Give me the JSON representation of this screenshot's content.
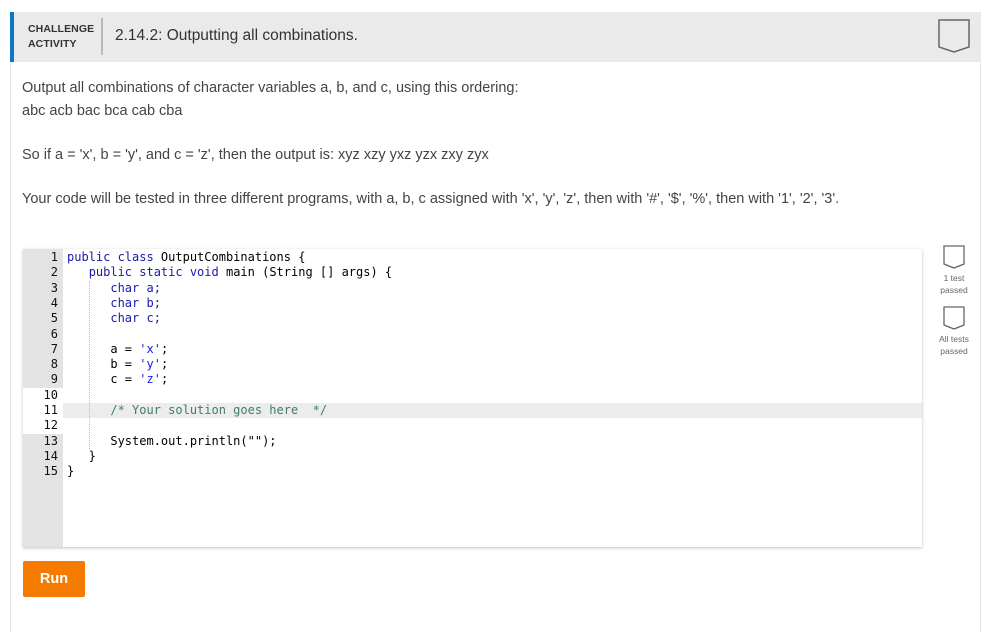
{
  "header": {
    "badge_line1": "CHALLENGE",
    "badge_line2": "ACTIVITY",
    "title": "2.14.2: Outputting all combinations.",
    "accent_color": "#0b78c6",
    "completion_icon": "bookmark-outline-icon"
  },
  "instructions": {
    "line1": "Output all combinations of character variables a, b, and c, using this ordering:",
    "line2": "abc acb bac bca cab cba",
    "example": "So if a = 'x', b = 'y', and c = 'z', then the output is: xyz xzy yxz yzx zxy zyx",
    "testing": "Your code will be tested in three different programs, with a, b, c assigned with 'x', 'y', 'z', then with '#', '$', '%', then with '1', '2', '3'."
  },
  "editor": {
    "active_line": 11,
    "editable_lines": [
      10,
      11,
      12
    ],
    "lines": [
      {
        "n": "1",
        "tokens": [
          [
            "kw",
            "public class "
          ],
          [
            "",
            "OutputCombinations {"
          ]
        ]
      },
      {
        "n": "2",
        "tokens": [
          [
            "",
            "   "
          ],
          [
            "kw",
            "public static void "
          ],
          [
            "",
            "main (String [] args) {"
          ]
        ]
      },
      {
        "n": "3",
        "tokens": [
          [
            "",
            "      "
          ],
          [
            "kw",
            "char "
          ],
          [
            "kw",
            "a;"
          ]
        ]
      },
      {
        "n": "4",
        "tokens": [
          [
            "",
            "      "
          ],
          [
            "kw",
            "char "
          ],
          [
            "kw",
            "b;"
          ]
        ]
      },
      {
        "n": "5",
        "tokens": [
          [
            "",
            "      "
          ],
          [
            "kw",
            "char "
          ],
          [
            "kw",
            "c;"
          ]
        ]
      },
      {
        "n": "6",
        "tokens": []
      },
      {
        "n": "7",
        "tokens": [
          [
            "",
            "      a = "
          ],
          [
            "str",
            "'x'"
          ],
          [
            "",
            ";"
          ]
        ]
      },
      {
        "n": "8",
        "tokens": [
          [
            "",
            "      b = "
          ],
          [
            "str",
            "'y'"
          ],
          [
            "",
            ";"
          ]
        ]
      },
      {
        "n": "9",
        "tokens": [
          [
            "",
            "      c = "
          ],
          [
            "str",
            "'z'"
          ],
          [
            "",
            ";"
          ]
        ]
      },
      {
        "n": "10",
        "tokens": []
      },
      {
        "n": "11",
        "tokens": [
          [
            "",
            "      "
          ],
          [
            "cm",
            "/* Your solution goes here  */"
          ]
        ]
      },
      {
        "n": "12",
        "tokens": []
      },
      {
        "n": "13",
        "tokens": [
          [
            "",
            "      System.out.println(\"\");"
          ]
        ]
      },
      {
        "n": "14",
        "tokens": [
          [
            "",
            "   }"
          ]
        ]
      },
      {
        "n": "15",
        "tokens": [
          [
            "",
            "}"
          ]
        ]
      }
    ]
  },
  "tests": [
    {
      "label_line1": "1 test",
      "label_line2": "passed",
      "icon": "bookmark-outline-icon"
    },
    {
      "label_line1": "All tests",
      "label_line2": "passed",
      "icon": "bookmark-outline-icon"
    }
  ],
  "run_button": {
    "label": "Run",
    "color": "#f57a00"
  }
}
